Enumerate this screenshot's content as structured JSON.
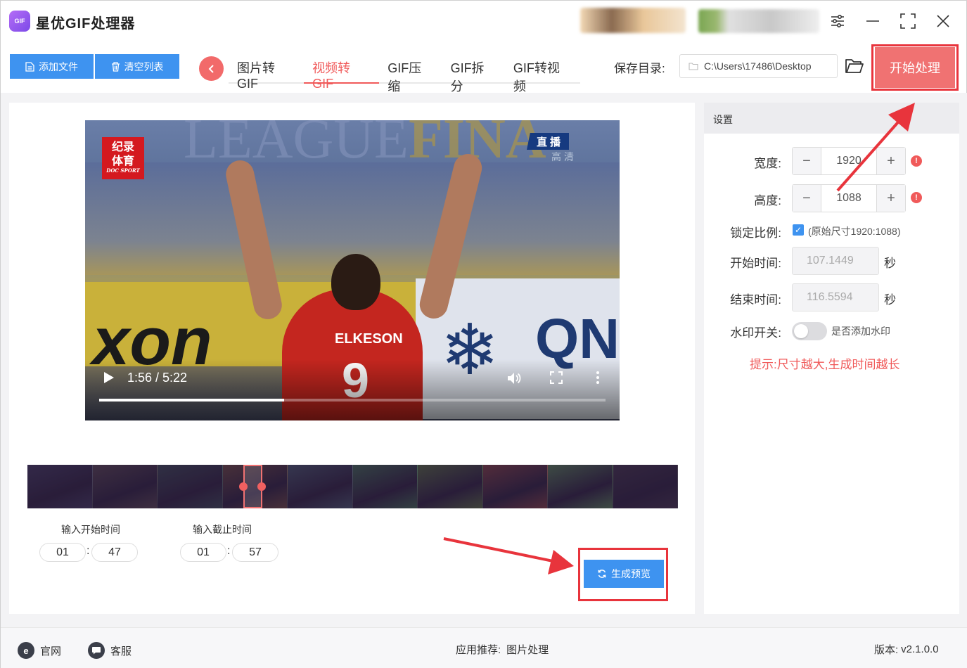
{
  "app": {
    "title": "星优GIF处理器",
    "logo_text": "GIF"
  },
  "window_controls": {
    "settings_icon": "sliders-icon",
    "minimize_icon": "minimize-icon",
    "maximize_icon": "maximize-icon",
    "close_icon": "close-icon"
  },
  "toolbar": {
    "add_file_label": "添加文件",
    "clear_list_label": "清空列表",
    "tabs": [
      {
        "label": "图片转GIF",
        "active": false
      },
      {
        "label": "视频转GIF",
        "active": true
      },
      {
        "label": "GIF压缩",
        "active": false
      },
      {
        "label": "GIF拆分",
        "active": false
      },
      {
        "label": "GIF转视频",
        "active": false
      }
    ],
    "save_dir_label": "保存目录:",
    "save_dir_path": "C:\\Users\\17486\\Desktop",
    "start_label": "开始处理"
  },
  "video": {
    "logo_line1": "纪录",
    "logo_line2": "体育",
    "logo_sub": "DOC SPORT",
    "live_tag": "直播",
    "hd_tag": "高清",
    "time_display": "1:56 / 5:22",
    "progress": 0.365,
    "jersey_name": "ELKESON",
    "jersey_number": "9",
    "banner_text": "xon",
    "banner_text2": "QN",
    "league_text": "LEAGUE",
    "final_text": "FINA"
  },
  "timeline": {
    "thumbnail_colors": [
      "#3a3550",
      "#4a3e44",
      "#354048",
      "#5a4038",
      "#3e4a5a",
      "#3a5a48",
      "#4a5a3a",
      "#6a3a3a",
      "#4a6a4a",
      "#3a3040"
    ]
  },
  "trim": {
    "start_label": "输入开始时间",
    "end_label": "输入截止时间",
    "start_min": "01",
    "start_sec": "47",
    "end_min": "01",
    "end_sec": "57",
    "preview_label": "生成预览"
  },
  "settings": {
    "header": "设置",
    "width_label": "宽度:",
    "width_value": "1920",
    "height_label": "高度:",
    "height_value": "1088",
    "lock_label": "锁定比例:",
    "lock_desc": "(原始尺寸1920:1088)",
    "start_label": "开始时间:",
    "start_value": "107.1449",
    "end_label": "结束时间:",
    "end_value": "116.5594",
    "sec_unit": "秒",
    "watermark_label": "水印开关:",
    "watermark_desc": "是否添加水印",
    "hint": "提示:尺寸越大,生成时间越长"
  },
  "footer": {
    "website_label": "官网",
    "service_label": "客服",
    "recommend_label": "应用推荐:",
    "recommend_value": "图片处理",
    "version_label": "版本:",
    "version_value": "v2.1.0.0"
  },
  "colors": {
    "accent_blue": "#3e93f0",
    "accent_red": "#f05a5a",
    "highlight_red": "#e8343c"
  }
}
